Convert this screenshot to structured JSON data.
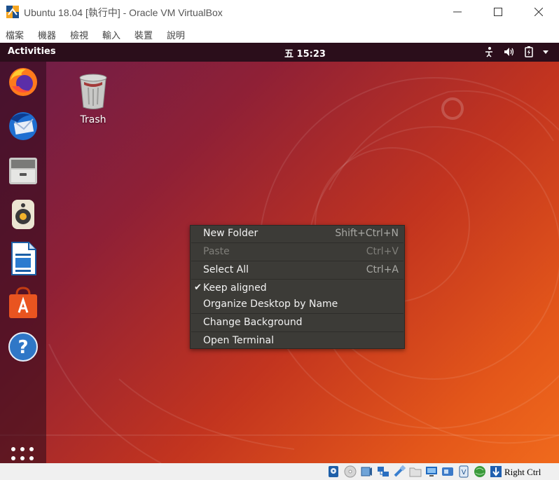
{
  "window": {
    "title": "Ubuntu 18.04 [執行中] - Oracle VM VirtualBox",
    "minimize_glyph": "—",
    "maximize_glyph": "☐",
    "close_glyph": "✕"
  },
  "menubar": {
    "items": [
      "檔案",
      "機器",
      "檢視",
      "輸入",
      "裝置",
      "說明"
    ]
  },
  "topbar": {
    "activities": "Activities",
    "clock": "五 15:23",
    "tray_icons": [
      "accessibility-icon",
      "volume-icon",
      "battery-icon",
      "system-menu-arrow-icon"
    ]
  },
  "dock": {
    "apps": [
      "firefox-icon",
      "thunderbird-icon",
      "files-icon",
      "rhythmbox-icon",
      "libreoffice-writer-icon",
      "ubuntu-software-icon",
      "help-icon"
    ],
    "show_apps_icon": "show-applications-icon"
  },
  "desktop": {
    "trash_label": "Trash"
  },
  "context_menu": {
    "items": [
      {
        "label": "New Folder",
        "accel": "Shift+Ctrl+N",
        "enabled": true
      },
      {
        "label": "Paste",
        "accel": "Ctrl+V",
        "enabled": false
      },
      {
        "label": "Select All",
        "accel": "Ctrl+A",
        "enabled": true
      },
      {
        "label": "Keep aligned",
        "accel": "",
        "enabled": true,
        "checked": true
      },
      {
        "label": "Organize Desktop by Name",
        "accel": "",
        "enabled": true
      },
      {
        "label": "Change Background",
        "accel": "",
        "enabled": true
      },
      {
        "label": "Open Terminal",
        "accel": "",
        "enabled": true
      }
    ]
  },
  "statusbar": {
    "icons": [
      "hard-disk-icon",
      "optical-drive-icon",
      "audio-icon",
      "network-icon",
      "usb-icon",
      "shared-folders-icon",
      "display-icon",
      "recording-icon",
      "cpu-icon",
      "mouse-integration-icon",
      "arrow-down-icon"
    ],
    "host_key": "Right Ctrl"
  },
  "colors": {
    "ubuntu_orange": "#e95420",
    "aubergine": "#2b0e1b",
    "menu_bg": "#3c3b37"
  }
}
